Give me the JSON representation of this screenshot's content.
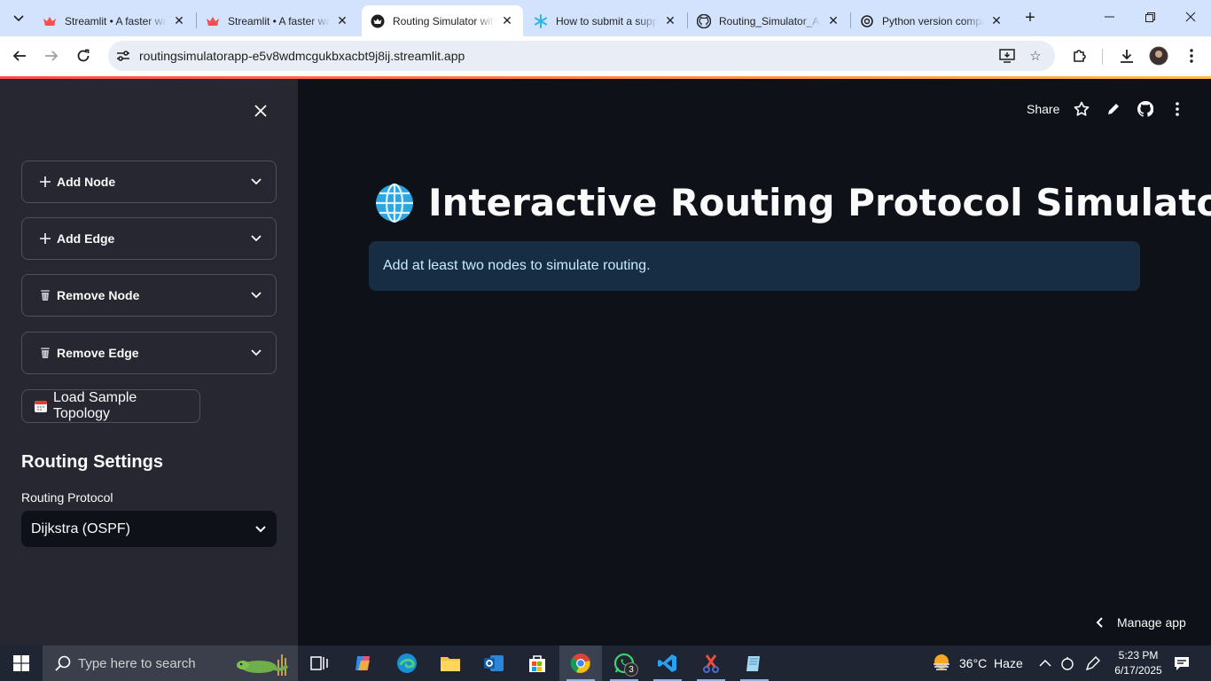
{
  "browser": {
    "tabs": [
      {
        "title": "Streamlit • A faster way to build and share data apps",
        "active": false,
        "favicon": "streamlit-crown-icon"
      },
      {
        "title": "Streamlit • A faster way to build and share data apps",
        "active": false,
        "favicon": "streamlit-crown-icon"
      },
      {
        "title": "Routing Simulator with Streamlit",
        "active": true,
        "favicon": "streamlit-app-icon"
      },
      {
        "title": "How to submit a support request",
        "active": false,
        "favicon": "snowflake-icon"
      },
      {
        "title": "Routing_Simulator_App",
        "active": false,
        "favicon": "github-icon"
      },
      {
        "title": "Python version compatibility",
        "active": false,
        "favicon": "openai-icon"
      }
    ],
    "url": "routingsimulatorapp-e5v8wdmcgukbxacbt9j8ij.streamlit.app"
  },
  "sidebar": {
    "expanders": [
      {
        "label": "Add Node",
        "icon": "plus-icon"
      },
      {
        "label": "Add Edge",
        "icon": "plus-icon"
      },
      {
        "label": "Remove Node",
        "icon": "trash-icon"
      },
      {
        "label": "Remove Edge",
        "icon": "trash-icon"
      }
    ],
    "sample_button": "Load Sample Topology",
    "settings_heading": "Routing Settings",
    "protocol_label": "Routing Protocol",
    "protocol_value": "Dijkstra (OSPF)"
  },
  "main": {
    "header": {
      "share": "Share"
    },
    "title": "Interactive Routing Protocol Simulator",
    "info": "Add at least two nodes to simulate routing.",
    "manage_app": "Manage app"
  },
  "taskbar": {
    "search_placeholder": "Type here to search",
    "whatsapp_badge": "3",
    "weather": "36°C  Haze",
    "time": "5:23 PM",
    "date": "6/17/2025"
  },
  "colors": {
    "sidebar_bg": "#262730",
    "main_bg": "#0e1117",
    "info_bg": "#172d43",
    "info_text": "#c7ebff",
    "accent": "#ff4b4b"
  }
}
